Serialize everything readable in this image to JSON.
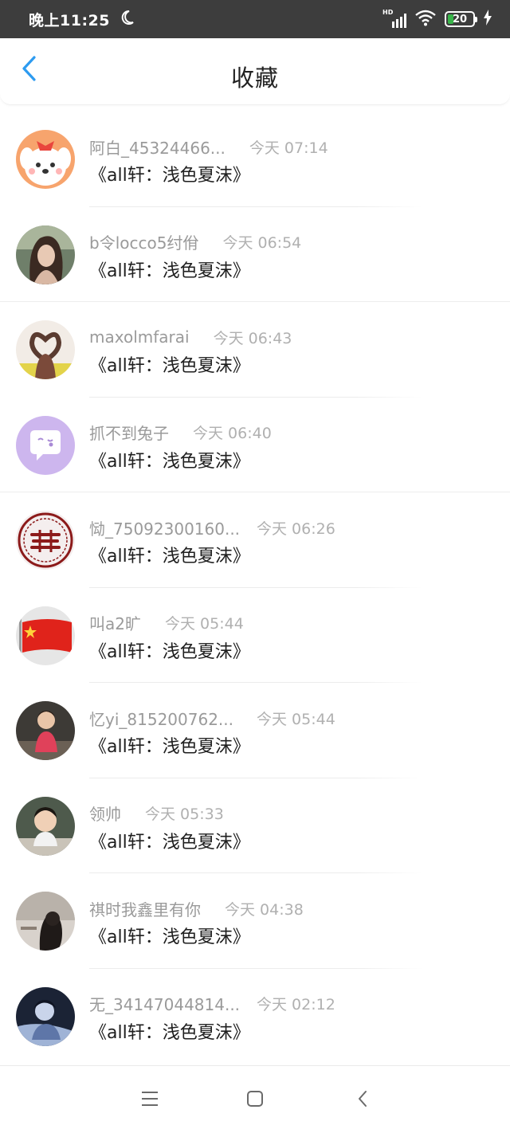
{
  "status_bar": {
    "time": "晚上11:25",
    "network": "HD",
    "battery": "20",
    "battery_level": 0.2,
    "colors": {
      "background": "#3d3d3d",
      "battery_fill": "#39b54a"
    },
    "icons": [
      "moon-icon",
      "signal-icon",
      "wifi-icon",
      "battery-icon",
      "charging-icon"
    ]
  },
  "header": {
    "title": "收藏",
    "back_icon": "chevron-left-icon",
    "accent_color": "#2d9bf0"
  },
  "favorites": [
    {
      "name": "阿白_45324466...",
      "time": "今天 07:14",
      "title": "《all轩：浅色夏沫》",
      "avatar": "cartoon-dog"
    },
    {
      "name": "b令locco5纣佾",
      "time": "今天 06:54",
      "title": "《all轩：浅色夏沫》",
      "avatar": "girl-portrait"
    },
    {
      "name": "maxolmfarai",
      "time": "今天 06:43",
      "title": "《all轩：浅色夏沫》",
      "avatar": "heart-hands"
    },
    {
      "name": "抓不到兔子",
      "time": "今天 06:40",
      "title": "《all轩：浅色夏沫》",
      "avatar": "chat-bubble"
    },
    {
      "name": "恸_75092300160...",
      "time": "今天 06:26",
      "title": "《all轩：浅色夏沫》",
      "avatar": "red-seal"
    },
    {
      "name": "叫a2旷",
      "time": "今天 05:44",
      "title": "《all轩：浅色夏沫》",
      "avatar": "china-flag"
    },
    {
      "name": "忆yi_815200762...",
      "time": "今天 05:44",
      "title": "《all轩：浅色夏沫》",
      "avatar": "child-photo"
    },
    {
      "name": "领帅",
      "time": "今天 05:33",
      "title": "《all轩：浅色夏沫》",
      "avatar": "child-portrait"
    },
    {
      "name": "祺时我鑫里有你",
      "time": "今天 04:38",
      "title": "《all轩：浅色夏沫》",
      "avatar": "dark-photo"
    },
    {
      "name": "无_34147044814...",
      "time": "今天 02:12",
      "title": "《all轩：浅色夏沫》",
      "avatar": "blue-photo"
    }
  ],
  "system_nav": {
    "icons": [
      "menu-icon",
      "home-icon",
      "back-icon"
    ]
  }
}
